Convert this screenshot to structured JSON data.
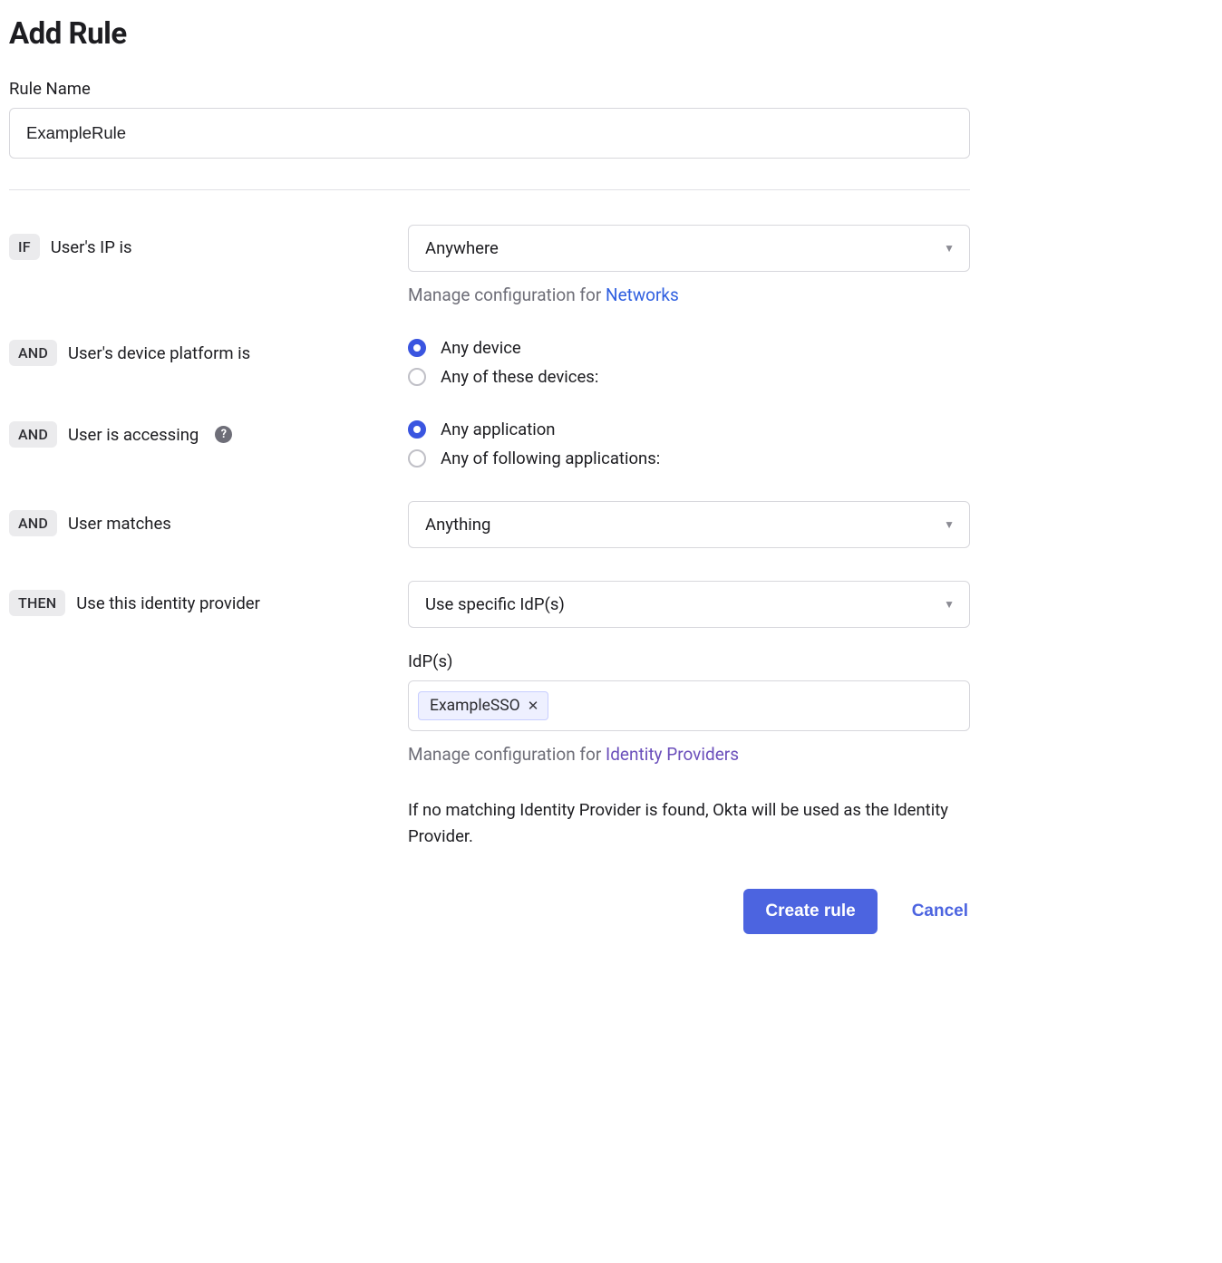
{
  "page_title": "Add Rule",
  "rule_name": {
    "label": "Rule Name",
    "value": "ExampleRule"
  },
  "conditions": {
    "ip": {
      "tag": "IF",
      "label": "User's IP is",
      "select_value": "Anywhere",
      "hint_prefix": "Manage configuration for ",
      "hint_link": "Networks"
    },
    "device": {
      "tag": "AND",
      "label": "User's device platform is",
      "options": {
        "any": "Any device",
        "specific": "Any of these devices:"
      },
      "selected": "any"
    },
    "accessing": {
      "tag": "AND",
      "label": "User is accessing",
      "options": {
        "any": "Any application",
        "specific": "Any of following applications:"
      },
      "selected": "any"
    },
    "matches": {
      "tag": "AND",
      "label": "User matches",
      "select_value": "Anything"
    }
  },
  "action": {
    "tag": "THEN",
    "label": "Use this identity provider",
    "select_value": "Use specific IdP(s)",
    "idps_label": "IdP(s)",
    "idps": [
      "ExampleSSO"
    ],
    "hint_prefix": "Manage configuration for ",
    "hint_link": "Identity Providers",
    "fallback_note": "If no matching Identity Provider is found, Okta will be used as the Identity Provider."
  },
  "buttons": {
    "primary": "Create rule",
    "cancel": "Cancel"
  }
}
